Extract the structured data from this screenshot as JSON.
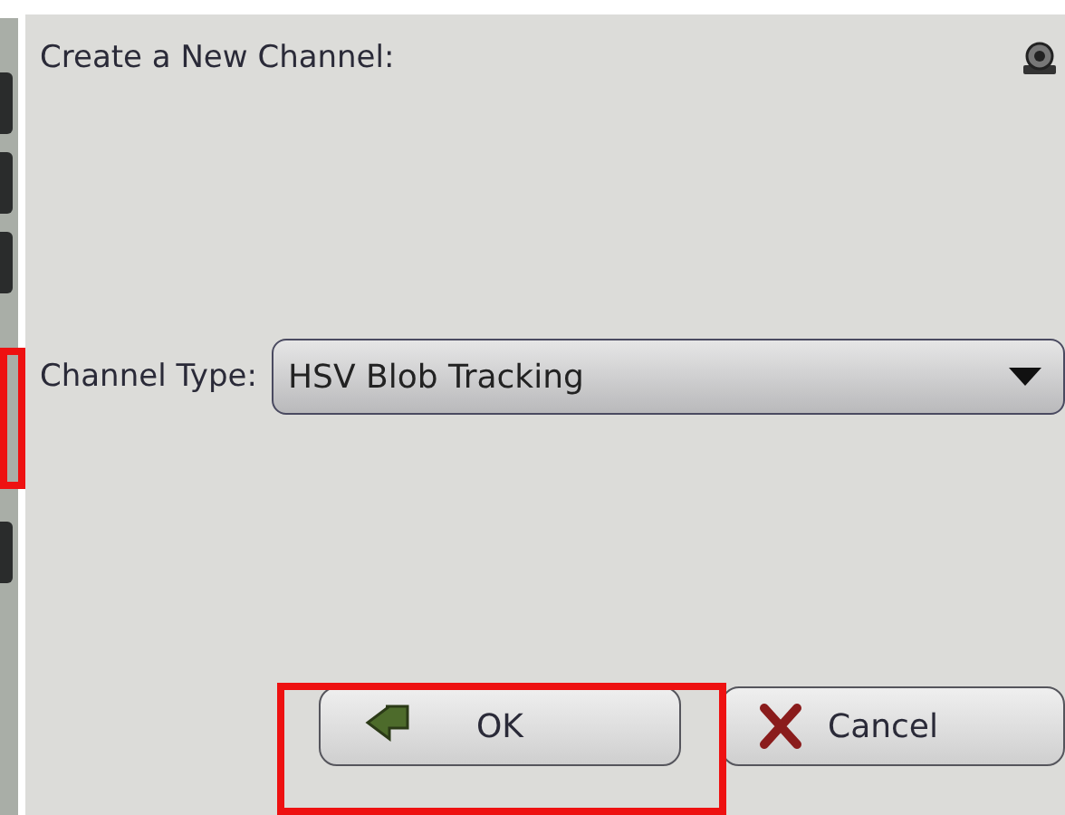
{
  "dialog": {
    "title": "Create a New Channel:"
  },
  "channel_type": {
    "label": "Channel Type:",
    "value": "HSV Blob Tracking"
  },
  "buttons": [
    {
      "label": "OK",
      "kind": "ok",
      "highlighted": true
    },
    {
      "label": "Cancel",
      "kind": "cancel",
      "highlighted": false
    }
  ]
}
